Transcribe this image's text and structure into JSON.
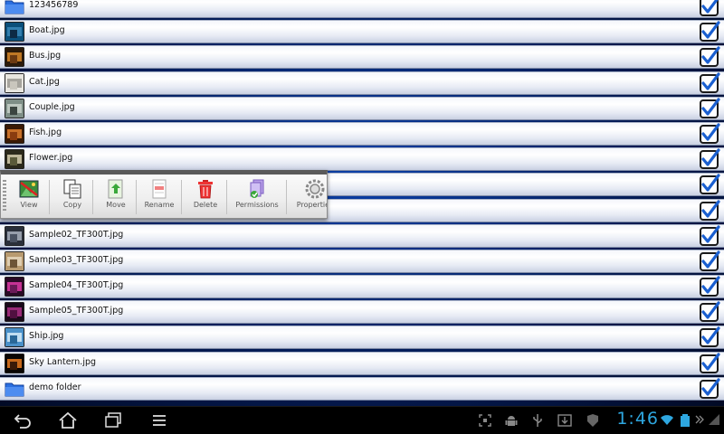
{
  "files": [
    {
      "name": "123456789",
      "thumb": "folder",
      "checked": true
    },
    {
      "name": "Boat.jpg",
      "thumb": "photo-boat",
      "checked": true
    },
    {
      "name": "Bus.jpg",
      "thumb": "photo-bus",
      "checked": true
    },
    {
      "name": "Cat.jpg",
      "thumb": "photo-cat",
      "checked": true
    },
    {
      "name": "Couple.jpg",
      "thumb": "photo-couple",
      "checked": true
    },
    {
      "name": "Fish.jpg",
      "thumb": "photo-fish",
      "checked": true
    },
    {
      "name": "Flower.jpg",
      "thumb": "photo-flower",
      "checked": true
    },
    {
      "name": "",
      "thumb": "none",
      "checked": true
    },
    {
      "name": "",
      "thumb": "none",
      "checked": true
    },
    {
      "name": "Sample02_TF300T.jpg",
      "thumb": "photo-sample02",
      "checked": true
    },
    {
      "name": "Sample03_TF300T.jpg",
      "thumb": "photo-sample03",
      "checked": true
    },
    {
      "name": "Sample04_TF300T.jpg",
      "thumb": "photo-sample04",
      "checked": true
    },
    {
      "name": "Sample05_TF300T.jpg",
      "thumb": "photo-sample05",
      "checked": true
    },
    {
      "name": "Ship.jpg",
      "thumb": "photo-ship",
      "checked": true
    },
    {
      "name": "Sky Lantern.jpg",
      "thumb": "photo-lantern",
      "checked": true
    },
    {
      "name": "demo folder",
      "thumb": "folder",
      "checked": true
    }
  ],
  "toolbar": {
    "items": [
      {
        "label": "View",
        "icon": "view-icon"
      },
      {
        "label": "Copy",
        "icon": "copy-icon"
      },
      {
        "label": "Move",
        "icon": "move-icon"
      },
      {
        "label": "Rename",
        "icon": "rename-icon"
      },
      {
        "label": "Delete",
        "icon": "delete-icon"
      },
      {
        "label": "Permissions",
        "icon": "permissions-icon"
      },
      {
        "label": "Properties",
        "icon": "properties-icon"
      }
    ]
  },
  "statusbar": {
    "time": "1:46",
    "clock_color": "#2ea7e0"
  },
  "colors": {
    "check_blue": "#1a5fd0",
    "folder_blue": "#2b6fe0"
  }
}
